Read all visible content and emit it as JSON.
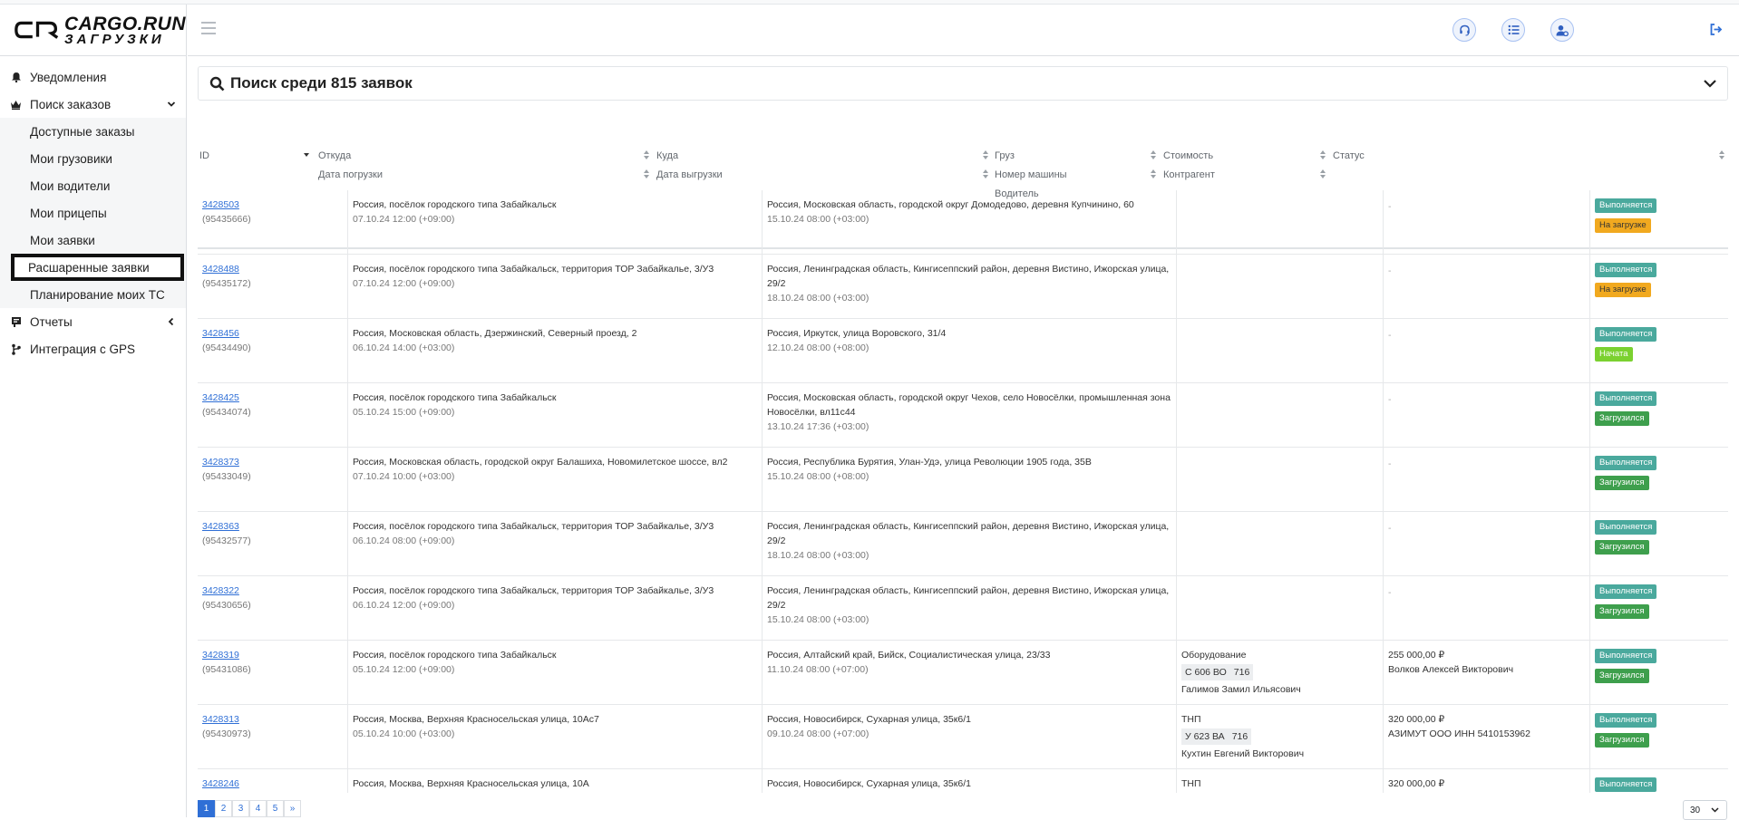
{
  "brand": {
    "name": "CARGO.RUN",
    "subtitle": "ЗАГРУЗКИ"
  },
  "sidebar": {
    "items": [
      {
        "label": "Уведомления",
        "icon": "bell-icon"
      },
      {
        "label": "Поиск заказов",
        "icon": "crown-icon",
        "expanded": true
      },
      {
        "label": "Отчеты",
        "icon": "report-icon"
      },
      {
        "label": "Интеграция с GPS",
        "icon": "gps-icon"
      }
    ],
    "subitems": [
      {
        "label": "Доступные заказы"
      },
      {
        "label": "Мои грузовики"
      },
      {
        "label": "Мои водители"
      },
      {
        "label": "Мои прицепы"
      },
      {
        "label": "Мои заявки"
      },
      {
        "label": "Расшаренные заявки",
        "highlighted": true
      },
      {
        "label": "Планирование моих ТС"
      }
    ]
  },
  "header": {
    "icons": [
      "headset-icon",
      "list-icon",
      "user-settings-icon",
      "logout-icon"
    ]
  },
  "search": {
    "title": "Поиск среди 815 заявок"
  },
  "table": {
    "headers": {
      "id": "ID",
      "from": "Откуда",
      "load_date": "Дата погрузки",
      "to": "Куда",
      "unload_date": "Дата выгрузки",
      "cargo": "Груз",
      "truck": "Номер машины",
      "driver": "Водитель",
      "cost": "Стоимость",
      "contractor": "Контрагент",
      "status": "Статус"
    },
    "rows": [
      {
        "id": "3428503",
        "sub": "(95435666)",
        "from": "Россия, посёлок городского типа Забайкальск",
        "from_date": "07.10.24 12:00 (+09:00)",
        "to": "Россия, Московская область, городской округ Домодедово, деревня Купчинино, 60",
        "to_date": "15.10.24 08:00 (+03:00)",
        "cargo": "",
        "plate": "",
        "region": "",
        "driver": "",
        "cost": "",
        "contractor": "",
        "cost_dash": "-",
        "status1": "Выполняется",
        "status2": "На загрузке",
        "s2class": "b-orange"
      },
      {
        "id": "3428488",
        "sub": "(95435172)",
        "from": "Россия, посёлок городского типа Забайкальск, территория ТОР Забайкалье, 3/У3",
        "from_date": "07.10.24 12:00 (+09:00)",
        "to": "Россия, Ленинградская область, Кингисеппский район, деревня Вистино, Ижорская улица, 29/2",
        "to_date": "18.10.24 08:00 (+03:00)",
        "cargo": "",
        "plate": "",
        "region": "",
        "driver": "",
        "cost": "",
        "contractor": "",
        "cost_dash": "-",
        "status1": "Выполняется",
        "status2": "На загрузке",
        "s2class": "b-orange"
      },
      {
        "id": "3428456",
        "sub": "(95434490)",
        "from": "Россия, Московская область, Дзержинский, Северный проезд, 2",
        "from_date": "06.10.24 14:00 (+03:00)",
        "to": "Россия, Иркутск, улица Воровского, 31/4",
        "to_date": "12.10.24 08:00 (+08:00)",
        "cargo": "",
        "plate": "",
        "region": "",
        "driver": "",
        "cost": "",
        "contractor": "",
        "cost_dash": "-",
        "status1": "Выполняется",
        "status2": "Начата",
        "s2class": "b-lime"
      },
      {
        "id": "3428425",
        "sub": "(95434074)",
        "from": "Россия, посёлок городского типа Забайкальск",
        "from_date": "05.10.24 15:00 (+09:00)",
        "to": "Россия, Московская область, городской округ Чехов, село Новосёлки, промышленная зона Новосёлки, вл11с44",
        "to_date": "13.10.24 17:36 (+03:00)",
        "cargo": "",
        "plate": "",
        "region": "",
        "driver": "",
        "cost": "",
        "contractor": "",
        "cost_dash": "-",
        "status1": "Выполняется",
        "status2": "Загрузился",
        "s2class": "b-green"
      },
      {
        "id": "3428373",
        "sub": "(95433049)",
        "from": "Россия, Московская область, городской округ Балашиха, Новомилетское шоссе, вл2",
        "from_date": "07.10.24 10:00 (+03:00)",
        "to": "Россия, Республика Бурятия, Улан-Удэ, улица Революции 1905 года, 35В",
        "to_date": "15.10.24 08:00 (+08:00)",
        "cargo": "",
        "plate": "",
        "region": "",
        "driver": "",
        "cost": "",
        "contractor": "",
        "cost_dash": "-",
        "status1": "Выполняется",
        "status2": "Загрузился",
        "s2class": "b-green"
      },
      {
        "id": "3428363",
        "sub": "(95432577)",
        "from": "Россия, посёлок городского типа Забайкальск, территория ТОР Забайкалье, 3/У3",
        "from_date": "06.10.24 08:00 (+09:00)",
        "to": "Россия, Ленинградская область, Кингисеппский район, деревня Вистино, Ижорская улица, 29/2",
        "to_date": "18.10.24 08:00 (+03:00)",
        "cargo": "",
        "plate": "",
        "region": "",
        "driver": "",
        "cost": "",
        "contractor": "",
        "cost_dash": "-",
        "status1": "Выполняется",
        "status2": "Загрузился",
        "s2class": "b-green"
      },
      {
        "id": "3428322",
        "sub": "(95430656)",
        "from": "Россия, посёлок городского типа Забайкальск, территория ТОР Забайкалье, 3/У3",
        "from_date": "06.10.24 12:00 (+09:00)",
        "to": "Россия, Ленинградская область, Кингисеппский район, деревня Вистино, Ижорская улица, 29/2",
        "to_date": "15.10.24 08:00 (+03:00)",
        "cargo": "",
        "plate": "",
        "region": "",
        "driver": "",
        "cost": "",
        "contractor": "",
        "cost_dash": "-",
        "status1": "Выполняется",
        "status2": "Загрузился",
        "s2class": "b-green"
      },
      {
        "id": "3428319",
        "sub": "(95431086)",
        "from": "Россия, посёлок городского типа Забайкальск",
        "from_date": "05.10.24 12:00 (+09:00)",
        "to": "Россия, Алтайский край, Бийск, Социалистическая улица, 23/33",
        "to_date": "11.10.24 08:00 (+07:00)",
        "cargo": "Оборудование",
        "plate": "С 606 ВО",
        "region": "716",
        "driver": "Галимов Замил Ильясович",
        "cost": "255 000,00 ₽",
        "contractor": "Волков Алексей Викторович",
        "cost_dash": "",
        "status1": "Выполняется",
        "status2": "Загрузился",
        "s2class": "b-green"
      },
      {
        "id": "3428313",
        "sub": "(95430973)",
        "from": "Россия, Москва, Верхняя Красносельская улица, 10Ас7",
        "from_date": "05.10.24 10:00 (+03:00)",
        "to": "Россия, Новосибирск, Сухарная улица, 35к6/1",
        "to_date": "09.10.24 08:00 (+07:00)",
        "cargo": "ТНП",
        "plate": "У 623 ВА",
        "region": "716",
        "driver": "Кухтин Евгений Викторович",
        "cost": "320 000,00 ₽",
        "contractor": "АЗИМУТ ООО ИНН 5410153962",
        "cost_dash": "",
        "status1": "Выполняется",
        "status2": "Загрузился",
        "s2class": "b-green"
      },
      {
        "id": "3428246",
        "sub": "",
        "from": "Россия, Москва, Верхняя Красносельская улица, 10А",
        "from_date": "",
        "to": "Россия, Новосибирск, Сухарная улица, 35к6/1",
        "to_date": "",
        "cargo": "ТНП",
        "plate": "",
        "region": "",
        "driver": "",
        "cost": "320 000,00 ₽",
        "contractor": "",
        "cost_dash": "",
        "status1": "Выполняется",
        "status2": "",
        "s2class": ""
      }
    ]
  },
  "pagination": {
    "pages": [
      "1",
      "2",
      "3",
      "4",
      "5",
      "»"
    ],
    "active": "1",
    "per_page": "30"
  },
  "colors": {
    "accent": "#2f6fd6",
    "teal": "#4aa99d",
    "orange": "#f1a91f",
    "lime": "#7bd130",
    "green": "#3e9f4d"
  }
}
